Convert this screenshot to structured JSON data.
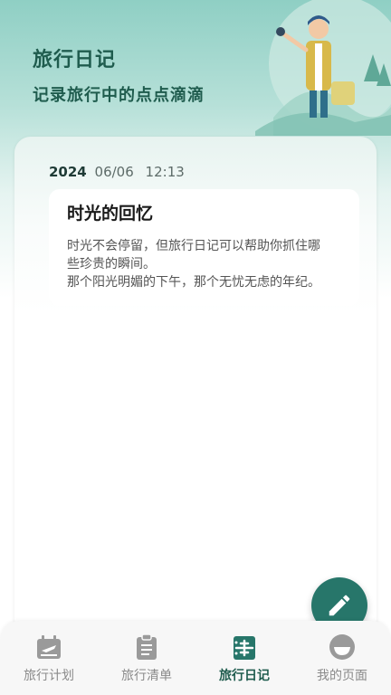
{
  "header": {
    "title": "旅行日记",
    "subtitle": "记录旅行中的点点滴滴"
  },
  "entry": {
    "year": "2024",
    "month_day": "06/06",
    "time": "12:13",
    "title": "时光的回忆",
    "text_line1": "时光不会停留，但旅行日记可以帮助你抓住哪",
    "text_line2": "些珍贵的瞬间。",
    "text_line3": "那个阳光明媚的下午，那个无忧无虑的年纪。"
  },
  "fab": {
    "icon": "pencil-icon"
  },
  "tabbar": {
    "items": [
      {
        "label": "旅行计划",
        "icon": "plane-calendar-icon"
      },
      {
        "label": "旅行清单",
        "icon": "clipboard-icon"
      },
      {
        "label": "旅行日记",
        "icon": "luggage-plane-icon"
      },
      {
        "label": "我的页面",
        "icon": "profile-icon"
      }
    ],
    "active_index": 2
  },
  "colors": {
    "accent": "#27766a",
    "title_text": "#1f5c4e",
    "inactive_tab": "#8a8a8a"
  }
}
